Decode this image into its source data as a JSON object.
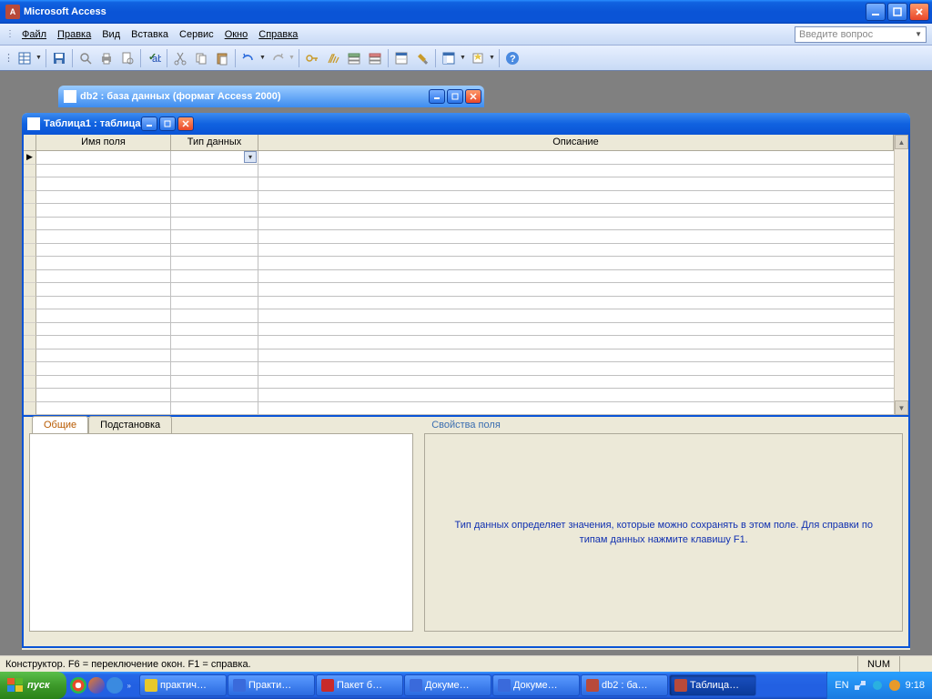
{
  "app": {
    "title": "Microsoft Access"
  },
  "menu": {
    "file": "Файл",
    "edit": "Правка",
    "view": "Вид",
    "insert": "Вставка",
    "tools": "Сервис",
    "window": "Окно",
    "help": "Справка",
    "question_placeholder": "Введите вопрос"
  },
  "db_window": {
    "title": "db2 : база данных (формат Access 2000)"
  },
  "table_window": {
    "title": "Таблица1 : таблица",
    "col_name": "Имя поля",
    "col_type": "Тип данных",
    "col_desc": "Описание"
  },
  "props": {
    "section_title": "Свойства поля",
    "tab_general": "Общие",
    "tab_lookup": "Подстановка",
    "hint": "Тип данных определяет значения, которые можно сохранять в этом поле.  Для справки по типам данных нажмите клавишу F1."
  },
  "status": {
    "text": "Конструктор.  F6 = переключение окон.  F1 = справка.",
    "num": "NUM"
  },
  "taskbar": {
    "start": "пуск",
    "items": [
      {
        "label": "практич…"
      },
      {
        "label": "Практи…"
      },
      {
        "label": "Пакет б…"
      },
      {
        "label": "Докуме…"
      },
      {
        "label": "Докуме…"
      },
      {
        "label": "db2 : ба…"
      },
      {
        "label": "Таблица…"
      }
    ],
    "lang": "EN",
    "clock": "9:18"
  }
}
